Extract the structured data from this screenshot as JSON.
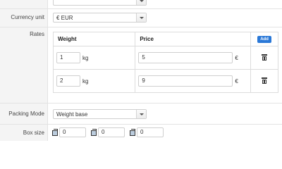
{
  "currency": {
    "label": "Currency unit",
    "value": "€ EUR"
  },
  "rates": {
    "label": "Rates",
    "col_weight": "Weight",
    "col_price": "Price",
    "add_label": "Add",
    "rows": [
      {
        "weight": "1",
        "weight_unit": "kg",
        "price": "5",
        "price_unit": "€"
      },
      {
        "weight": "2",
        "weight_unit": "kg",
        "price": "9",
        "price_unit": "€"
      }
    ]
  },
  "packing": {
    "label": "Packing Mode",
    "value": "Weight base"
  },
  "box_size": {
    "label": "Box size",
    "values": [
      "0",
      "0",
      "0"
    ]
  }
}
